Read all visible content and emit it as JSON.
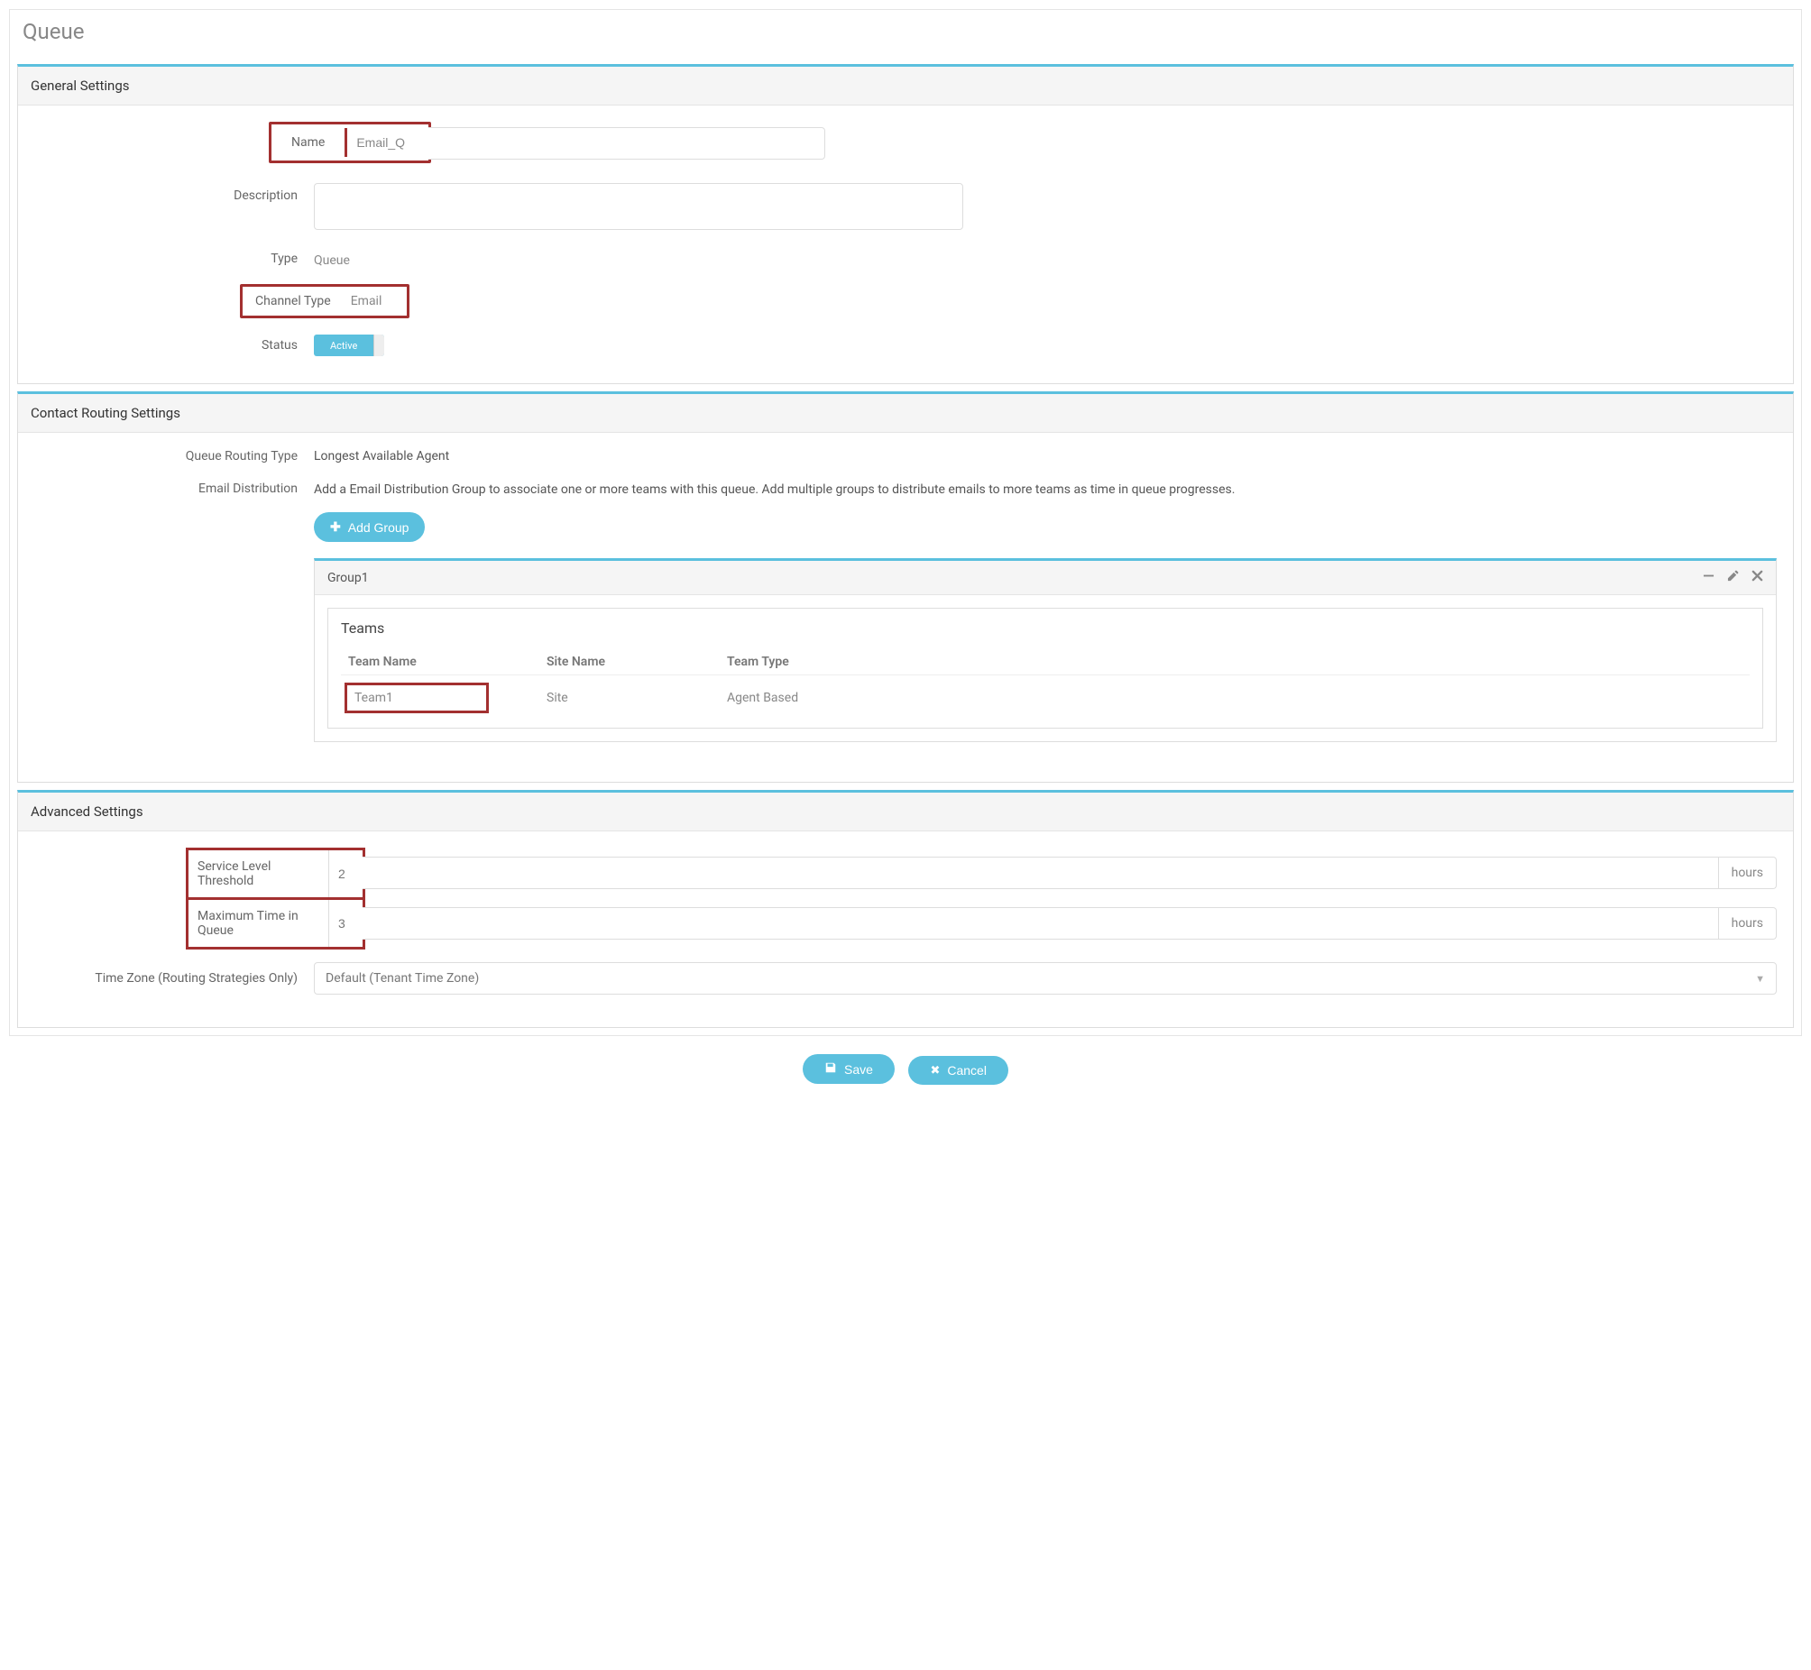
{
  "page": {
    "title": "Queue"
  },
  "sections": {
    "general": {
      "header": "General Settings",
      "name_label": "Name",
      "name_value": "Email_Q",
      "description_label": "Description",
      "description_value": "",
      "type_label": "Type",
      "type_value": "Queue",
      "channel_type_label": "Channel Type",
      "channel_type_value": "Email",
      "status_label": "Status",
      "status_value": "Active"
    },
    "routing": {
      "header": "Contact Routing Settings",
      "queue_routing_type_label": "Queue Routing Type",
      "queue_routing_type_value": "Longest Available Agent",
      "email_distribution_label": "Email Distribution",
      "email_distribution_desc": "Add a Email Distribution Group to associate one or more teams with this queue. Add multiple groups to distribute emails to more teams as time in queue progresses.",
      "add_group_label": "Add Group",
      "group": {
        "title": "Group1",
        "teams_title": "Teams",
        "columns": {
          "team_name": "Team Name",
          "site_name": "Site Name",
          "team_type": "Team Type"
        },
        "rows": [
          {
            "team_name": "Team1",
            "site_name": "Site",
            "team_type": "Agent Based"
          }
        ]
      }
    },
    "advanced": {
      "header": "Advanced Settings",
      "service_level_label": "Service Level Threshold",
      "service_level_value": "2",
      "service_level_unit": "hours",
      "max_time_label": "Maximum Time in Queue",
      "max_time_value": "3",
      "max_time_unit": "hours",
      "timezone_label": "Time Zone (Routing Strategies Only)",
      "timezone_value": "Default (Tenant Time Zone)"
    }
  },
  "footer": {
    "save_label": "Save",
    "cancel_label": "Cancel"
  }
}
